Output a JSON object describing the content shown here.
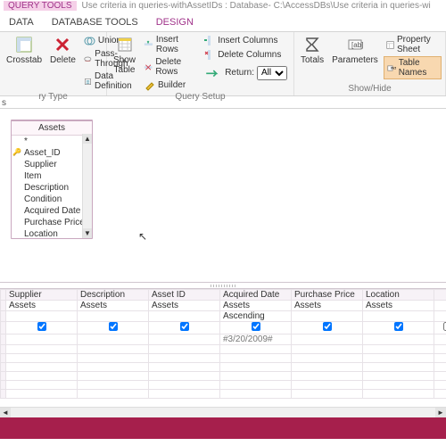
{
  "title": {
    "tool_tab": "QUERY TOOLS",
    "caption": "Use criteria in queries-withAssetIDs : Database- C:\\AccessDBs\\Use criteria in queries-wi"
  },
  "tabs": {
    "data": "DATA",
    "database_tools": "DATABASE TOOLS",
    "design": "DESIGN"
  },
  "ribbon": {
    "query_type": {
      "crosstab": "Crosstab",
      "delete": "Delete",
      "union": "Union",
      "pass_through": "Pass-Through",
      "data_def": "Data Definition",
      "group": "ry Type"
    },
    "setup": {
      "show_table": "Show\nTable",
      "insert_rows": "Insert Rows",
      "delete_rows": "Delete Rows",
      "builder": "Builder",
      "insert_cols": "Insert Columns",
      "delete_cols": "Delete Columns",
      "return": "Return:",
      "return_val": "All",
      "group": "Query Setup"
    },
    "showhide": {
      "totals": "Totals",
      "parameters": "Parameters",
      "property_sheet": "Property Sheet",
      "table_names": "Table Names",
      "group": "Show/Hide"
    }
  },
  "table_box": {
    "title": "Assets",
    "star": "*",
    "fields": [
      "Asset_ID",
      "Supplier",
      "Item",
      "Description",
      "Condition",
      "Acquired Date",
      "Purchase Price",
      "Location"
    ]
  },
  "grid": {
    "columns": [
      {
        "field": "Supplier",
        "table": "Assets",
        "sort": "",
        "show": true,
        "criteria": ""
      },
      {
        "field": "Description",
        "table": "Assets",
        "sort": "",
        "show": true,
        "criteria": ""
      },
      {
        "field": "Asset ID",
        "table": "Assets",
        "sort": "",
        "show": true,
        "criteria": ""
      },
      {
        "field": "Acquired Date",
        "table": "Assets",
        "sort": "Ascending",
        "show": true,
        "criteria": "#3/20/2009#"
      },
      {
        "field": "Purchase Price",
        "table": "Assets",
        "sort": "",
        "show": true,
        "criteria": ""
      },
      {
        "field": "Location",
        "table": "Assets",
        "sort": "",
        "show": true,
        "criteria": ""
      }
    ]
  },
  "tab_strip": {
    "label": "s"
  }
}
